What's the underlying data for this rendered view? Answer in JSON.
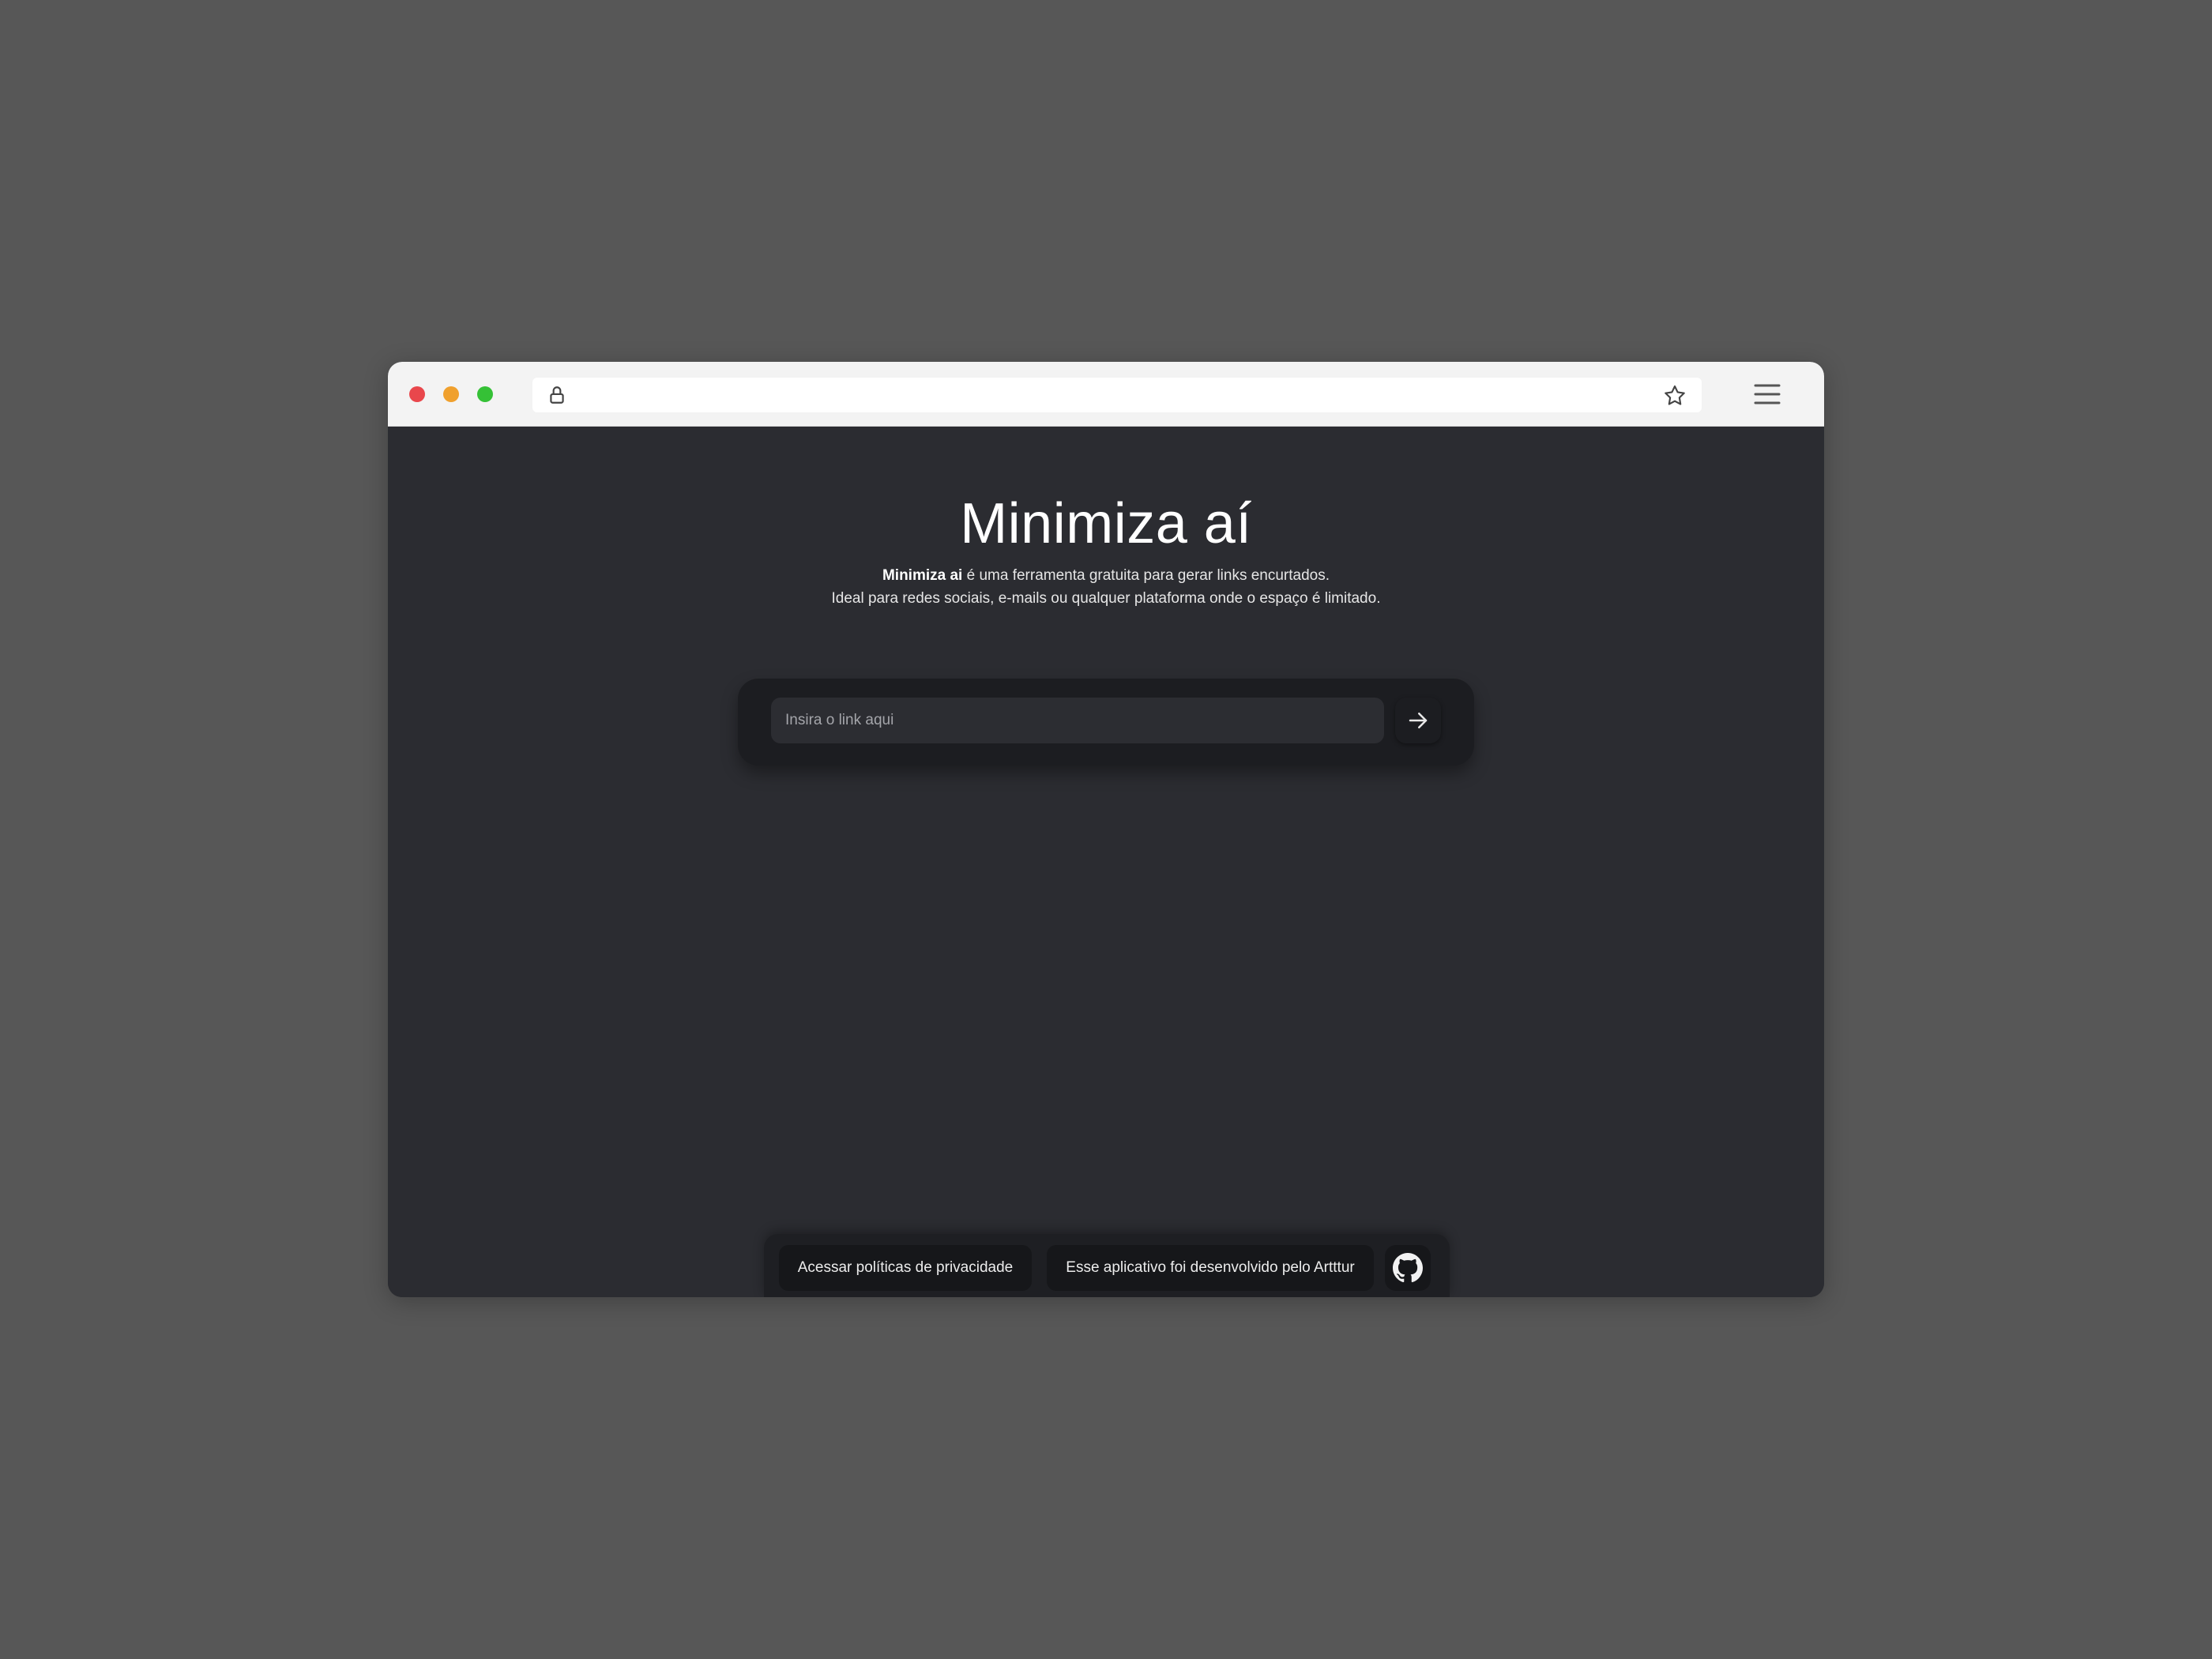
{
  "browser": {
    "address_url": ""
  },
  "hero": {
    "title": "Minimiza aí",
    "subtitle_brand": "Minimiza ai",
    "subtitle_rest": " é uma ferramenta gratuita para gerar links encurtados.",
    "subtitle_line2": "Ideal para redes sociais, e-mails ou qualquer plataforma onde o espaço é limitado."
  },
  "shortener": {
    "input_value": "",
    "input_placeholder": "Insira o link aqui",
    "submit_icon": "arrow-right-icon"
  },
  "footer": {
    "privacy_label": "Acessar políticas de privacidade",
    "author_label": "Esse aplicativo foi desenvolvido pelo Artttur",
    "github_icon": "github-icon"
  },
  "colors": {
    "window_dots": [
      "#e9474c",
      "#f0a02d",
      "#35c136"
    ],
    "page_background": "#2b2c31",
    "card_background": "#1c1d21"
  }
}
